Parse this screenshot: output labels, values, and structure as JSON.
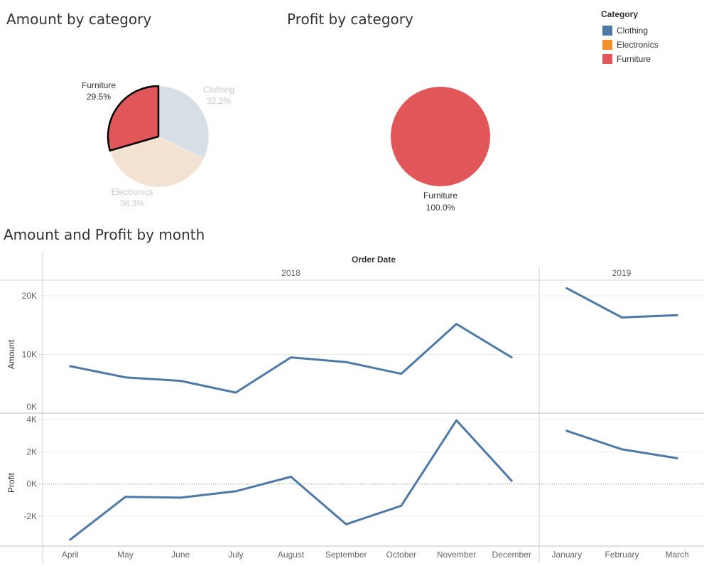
{
  "titles": {
    "amount_by_category": "Amount by category",
    "profit_by_category": "Profit by category",
    "amount_profit_by_month": "Amount and Profit by month"
  },
  "legend": {
    "title": "Category",
    "items": [
      {
        "label": "Clothing",
        "color": "#4e79a7"
      },
      {
        "label": "Electronics",
        "color": "#f28e2b"
      },
      {
        "label": "Furniture",
        "color": "#e15759"
      }
    ]
  },
  "chart_data": [
    {
      "type": "pie",
      "title": "Amount by category",
      "slices": [
        {
          "label": "Clothing",
          "pct_label": "32.2%",
          "value": 32.2,
          "color": "#d7dee5",
          "highlighted": false
        },
        {
          "label": "Electronics",
          "pct_label": "38.3%",
          "value": 38.3,
          "color": "#f3e2d2",
          "highlighted": false
        },
        {
          "label": "Furniture",
          "pct_label": "29.5%",
          "value": 29.5,
          "color": "#e15759",
          "highlighted": true
        }
      ]
    },
    {
      "type": "pie",
      "title": "Profit by category",
      "slices": [
        {
          "label": "Furniture",
          "pct_label": "100.0%",
          "value": 100,
          "color": "#e15759"
        }
      ]
    },
    {
      "type": "line",
      "title": "Amount and Profit by month",
      "header": "Order Date",
      "years": [
        {
          "label": "2018",
          "months": [
            "April",
            "May",
            "June",
            "July",
            "August",
            "September",
            "October",
            "November",
            "December"
          ]
        },
        {
          "label": "2019",
          "months": [
            "January",
            "February",
            "March"
          ]
        }
      ],
      "series": [
        {
          "name": "Amount",
          "axis_label": "Amount",
          "color": "#4e79a7",
          "ylim": [
            0,
            22000
          ],
          "ticks": [
            {
              "value": 0,
              "label": "0K"
            },
            {
              "value": 10000,
              "label": "10K"
            },
            {
              "value": 20000,
              "label": "20K"
            }
          ],
          "values": [
            [
              8000,
              6100,
              5500,
              3500,
              9500,
              8700,
              6700,
              15200,
              9500
            ],
            [
              21300,
              16300,
              16700
            ]
          ]
        },
        {
          "name": "Profit",
          "axis_label": "Profit",
          "color": "#4e79a7",
          "ylim": [
            -3900,
            4200
          ],
          "ticks": [
            {
              "value": -2000,
              "label": "-2K"
            },
            {
              "value": 0,
              "label": "0K"
            },
            {
              "value": 2000,
              "label": "2K"
            },
            {
              "value": 4000,
              "label": "4K"
            }
          ],
          "zero_line": true,
          "values": [
            [
              -3450,
              -800,
              -850,
              -450,
              450,
              -2500,
              -1350,
              3950,
              200
            ],
            [
              3300,
              2150,
              1600
            ]
          ]
        }
      ]
    }
  ]
}
